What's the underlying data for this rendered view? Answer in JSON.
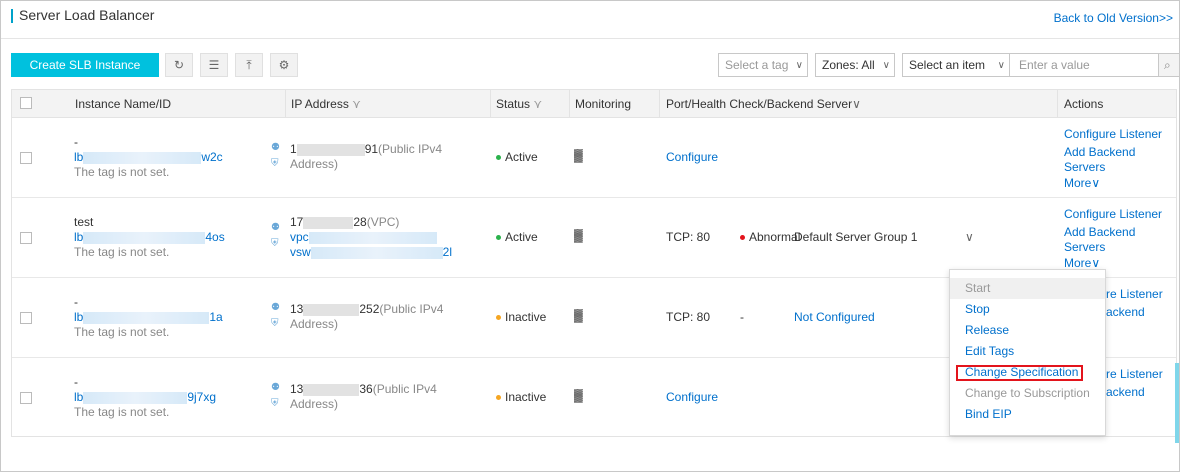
{
  "header": {
    "title": "Server Load Balancer",
    "back_link": "Back to Old Version>>"
  },
  "toolbar": {
    "create_button": "Create SLB Instance",
    "icons": [
      "refresh-icon",
      "list-icon",
      "export-icon",
      "settings-icon"
    ]
  },
  "filters": {
    "tag_placeholder": "Select a tag",
    "zones_label": "Zones: All",
    "item_select": "Select an item",
    "value_placeholder": "Enter a value"
  },
  "table": {
    "columns": {
      "name": "Instance Name/ID",
      "ip": "IP Address",
      "status": "Status",
      "monitoring": "Monitoring",
      "port": "Port/Health Check/Backend Server",
      "actions": "Actions"
    },
    "rows": [
      {
        "name": "-",
        "id_prefix": "lb",
        "id_suffix": "w2c",
        "tag": "The tag is not set.",
        "ip_prefix": "1",
        "ip_suffix": "91",
        "ip_note": "(Public IPv4",
        "ip_note2": "Address)",
        "status": "Active",
        "port_text": "Configure",
        "action1": "Configure Listener",
        "action2": "Add Backend",
        "action2b": "Servers",
        "more": "More"
      },
      {
        "name": "test",
        "id_prefix": "lb",
        "id_suffix": "4os",
        "tag": "The tag is not set.",
        "ip_prefix": "17",
        "ip_suffix": "28",
        "ip_note": "(VPC)",
        "vpc_prefix": "vpc",
        "vsw_prefix": "vsw",
        "vsw_suffix": "2l",
        "status": "Active",
        "port_text": "TCP: 80",
        "health": "Abnormal",
        "backend": "Default Server Group 1",
        "action1": "Configure Listener",
        "action2": "Add Backend",
        "action2b": "Servers",
        "more": "More"
      },
      {
        "name": "-",
        "id_prefix": "lb",
        "id_suffix": "1a",
        "tag": "The tag is not set.",
        "ip_prefix": "13",
        "ip_suffix": "252",
        "ip_note": "(Public IPv4",
        "ip_note2": "Address)",
        "status": "Inactive",
        "port_text": "TCP: 80",
        "health": "-",
        "backend": "Not Configured",
        "action1_partial": "re Listener",
        "action2_partial": "ackend"
      },
      {
        "name": "-",
        "id_prefix": "lb",
        "id_suffix": "9j7xg",
        "tag": "The tag is not set.",
        "ip_prefix": "13",
        "ip_suffix": "36",
        "ip_note": "(Public IPv4",
        "ip_note2": "Address)",
        "status": "Inactive",
        "port_text": "Configure",
        "action1_partial": "re Listener",
        "action2_partial": "ackend"
      }
    ]
  },
  "dropdown": {
    "items": [
      "Start",
      "Stop",
      "Release",
      "Edit Tags",
      "Change Specification",
      "Change to Subscription",
      "Bind EIP"
    ]
  },
  "colors": {
    "accent": "#00c1de",
    "link": "#0070cc",
    "active": "#2bb24c",
    "inactive": "#f5a623",
    "abnormal": "#e3141c"
  }
}
